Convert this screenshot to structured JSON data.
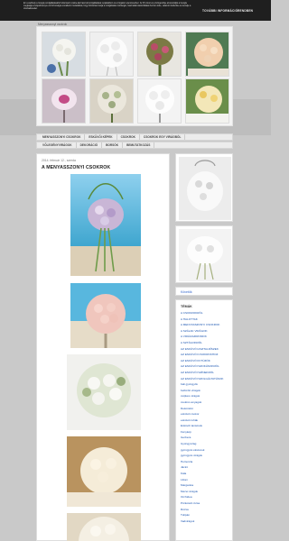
{
  "cookie_bar": {
    "text": "Ez a webhely a Google szolgáltatásaiból származó cookie-kat használ szolgáltatásai nyújtásához és a forgalom elemzéséhez. Az IP-címét és a böngészője azonosítóját a Google megkapja a teljesítményre és biztonságra vonatkozó mutatókkal, hogy biztosítani tudja a szolgáltatás minőségét, használati statisztikákat hozzon létre, valamint felderítse és kezelje a visszaéléseket.",
    "learn_more": "TOVÁBBI INFORMÁCIÓ",
    "ok": "RENDBEN"
  },
  "blog": {
    "title": "Menyasszonyi csokrok"
  },
  "nav": {
    "row1": [
      "MENYASSZONYI CSOKROK",
      "ESKÜVŐI KÉPEK",
      "CSOKROK",
      "CSOKROK EGY VIRÁGBÓL"
    ],
    "row2": [
      "VŐLEGÉNYVIRÁGOK",
      "DEKORÁCIÓ",
      "BORSÓK",
      "BEMUTATKOZÁS"
    ]
  },
  "post": {
    "date": "2014. február 12., szerda",
    "title": "A MENYASSZONYI CSOKROK"
  },
  "sidebar": {
    "follow_link": "Követők",
    "labels_title": "TÉMÁK",
    "labels": [
      "A CSOKROKRÓL",
      "A HALOTTAK",
      "A MENYASSZONYI CSOKROK",
      "A SZÁLAK VIRÁGOK",
      "A VIRÁGSZIROMOK",
      "A SZTÁGOKRÓL",
      "AZ ESKÜVŐI ASZTALDÍSZEK",
      "AZ ESKÜVŐI CSOKROKHOZ",
      "AZ ESKÜVŐI KITŰZŐK",
      "AZ ESKÜVŐI SZOKÁSOKRÓL",
      "AZ ESKÜVŐI SZÍNEKRŐL",
      "AZ ESKÜVŐI SZOLGÁLTATÁSOK",
      "bali gyöngyök",
      "befüzött virágok",
      "csipkés virágok",
      "csokros anyagok",
      "Dekoráció",
      "esküvői csokor",
      "esküvői ruhák",
      "Esküvői tanácsok",
      "Fénykép",
      "Gerbera",
      "Gyöngyvirág",
      "gyöngyös ékszerek",
      "gyöngyös virágok",
      "Hortenzia",
      "Jácint",
      "Kála",
      "Liliom",
      "Margaréta",
      "Mezei virágok",
      "Orchidea",
      "Pünkösdi rózsa",
      "Rózsa",
      "Tulipán",
      "Vadvirágok"
    ]
  },
  "colors": {
    "cookie_bg": "#1f1f1f",
    "page_bg": "#c9c9c9",
    "link": "#1a55b0"
  }
}
